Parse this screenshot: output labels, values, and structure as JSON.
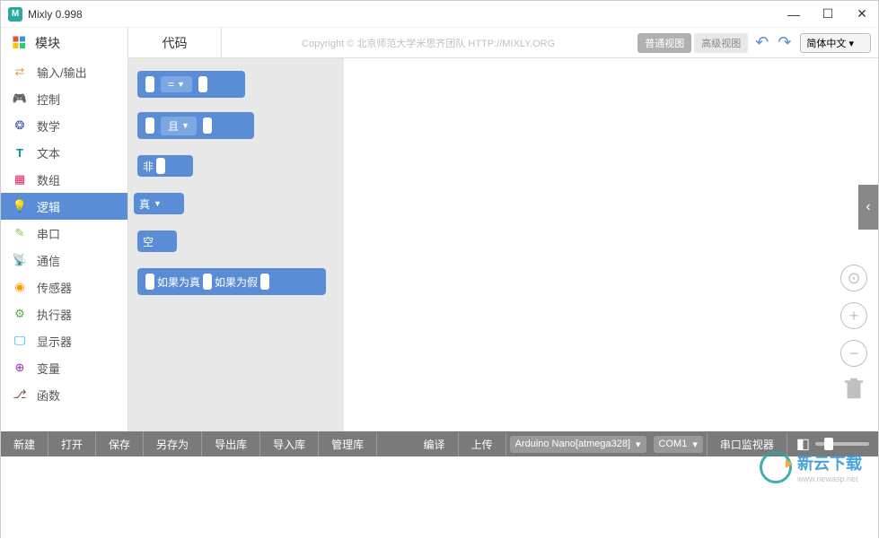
{
  "titlebar": {
    "app_name": "Mixly 0.998"
  },
  "tabs": {
    "blocks": "模块",
    "code": "代码"
  },
  "copyright": "Copyright © 北京师范大学米思齐团队 HTTP://MIXLY.ORG",
  "view": {
    "normal": "普通视图",
    "advanced": "高级视图"
  },
  "language": {
    "selected": "简体中文"
  },
  "sidebar": {
    "items": [
      {
        "label": "输入/输出",
        "icon": "io",
        "color": "#d9a05b"
      },
      {
        "label": "控制",
        "icon": "control",
        "color": "#7cb342"
      },
      {
        "label": "数学",
        "icon": "math",
        "color": "#3f51b5"
      },
      {
        "label": "文本",
        "icon": "text",
        "color": "#009688"
      },
      {
        "label": "数组",
        "icon": "array",
        "color": "#e91e63"
      },
      {
        "label": "逻辑",
        "icon": "logic",
        "color": "#ffffff",
        "active": true
      },
      {
        "label": "串口",
        "icon": "serial",
        "color": "#8bc34a"
      },
      {
        "label": "通信",
        "icon": "comm",
        "color": "#4caf50"
      },
      {
        "label": "传感器",
        "icon": "sensor",
        "color": "#ff9800"
      },
      {
        "label": "执行器",
        "icon": "actuator",
        "color": "#4caf50"
      },
      {
        "label": "显示器",
        "icon": "display",
        "color": "#03a9f4"
      },
      {
        "label": "变量",
        "icon": "var",
        "color": "#9c27b0"
      },
      {
        "label": "函数",
        "icon": "func",
        "color": "#795548"
      }
    ]
  },
  "blocks": {
    "compare_op": "=",
    "logic_and": "且",
    "logic_not": "非",
    "bool_true": "真",
    "null_val": "空",
    "if_true": "如果为真",
    "if_false": "如果为假"
  },
  "bottombar": {
    "new": "新建",
    "open": "打开",
    "save": "保存",
    "saveas": "另存为",
    "export": "导出库",
    "import": "导入库",
    "manage": "管理库",
    "compile": "编译",
    "upload": "上传",
    "board": "Arduino Nano[atmega328]",
    "port": "COM1",
    "monitor": "串口监视器"
  },
  "watermark": {
    "text": "新云下载",
    "sub": "www.newasp.net"
  }
}
